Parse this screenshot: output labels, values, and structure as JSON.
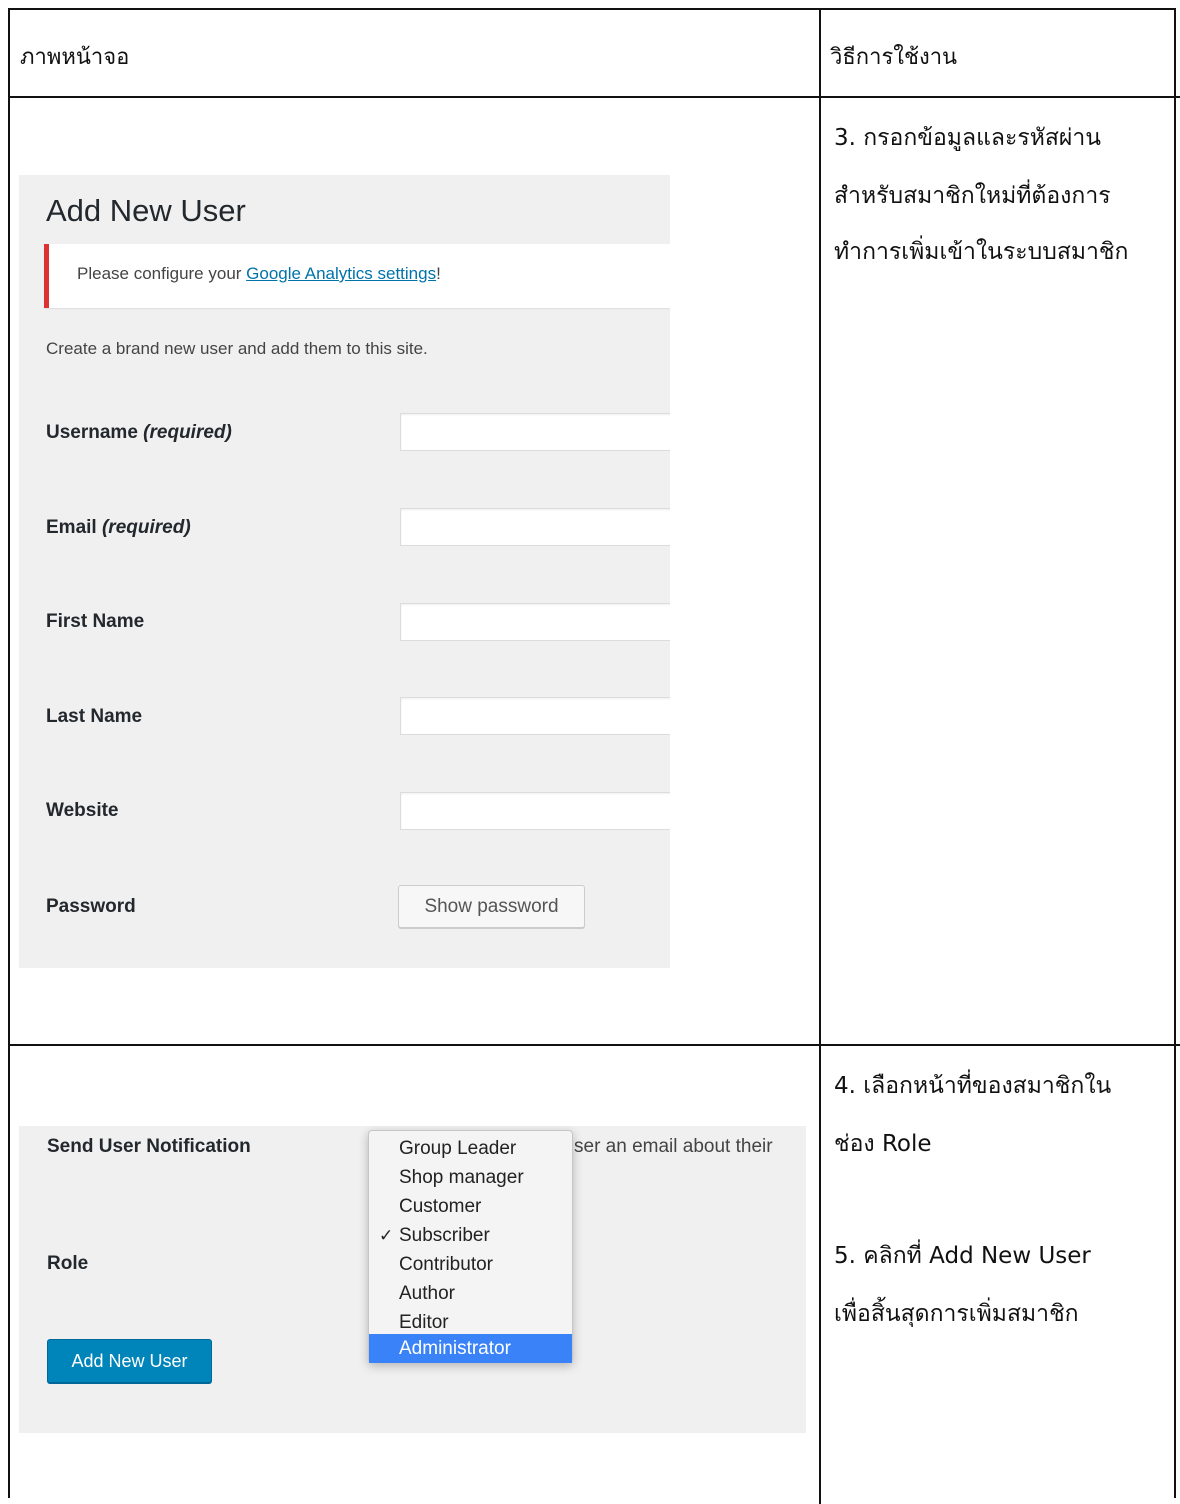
{
  "table": {
    "header_left": "ภาพหน้าจอ",
    "header_right": "วิธีการใช้งาน"
  },
  "steps": {
    "step3_line1": "3. กรอกข้อมูลและรหัสผ่าน",
    "step3_line2": "สำหรับสมาชิกใหม่ที่ต้องการ",
    "step3_line3": "ทำการเพิ่มเข้าในระบบสมาชิก",
    "step4_line1": "4. เลือกหน้าที่ของสมาชิกใน",
    "step4_line2": "ช่อง Role",
    "step5_line1": "5. คลิกที่ Add New User",
    "step5_line2": "เพื่อสิ้นสุดการเพิ่มสมาชิก"
  },
  "add_user_form": {
    "title": "Add New User",
    "notice_prefix": "Please configure your ",
    "notice_link": "Google Analytics settings",
    "notice_suffix": "!",
    "intro": "Create a brand new user and add them to this site.",
    "fields": [
      {
        "label": "Username",
        "qualifier": "(required)",
        "value": ""
      },
      {
        "label": "Email",
        "qualifier": "(required)",
        "value": ""
      },
      {
        "label": "First Name",
        "qualifier": "",
        "value": ""
      },
      {
        "label": "Last Name",
        "qualifier": "",
        "value": ""
      },
      {
        "label": "Website",
        "qualifier": "",
        "value": ""
      }
    ],
    "password_label": "Password",
    "show_password_button": "Show password"
  },
  "role_section": {
    "send_notification_label": "Send User Notification",
    "notification_text_partial": "ser an email about their",
    "role_label": "Role",
    "add_button": "Add New User",
    "checkmark": "✓",
    "role_options": [
      "Group Leader",
      "Shop manager",
      "Customer",
      "Subscriber",
      "Contributor",
      "Author",
      "Editor",
      "Administrator"
    ],
    "checked_option": "Subscriber",
    "highlighted_option": "Administrator"
  },
  "colors": {
    "notice_border": "#dc3232",
    "link": "#0073aa",
    "primary_button": "#0085ba",
    "dropdown_highlight": "#3a82f7"
  }
}
